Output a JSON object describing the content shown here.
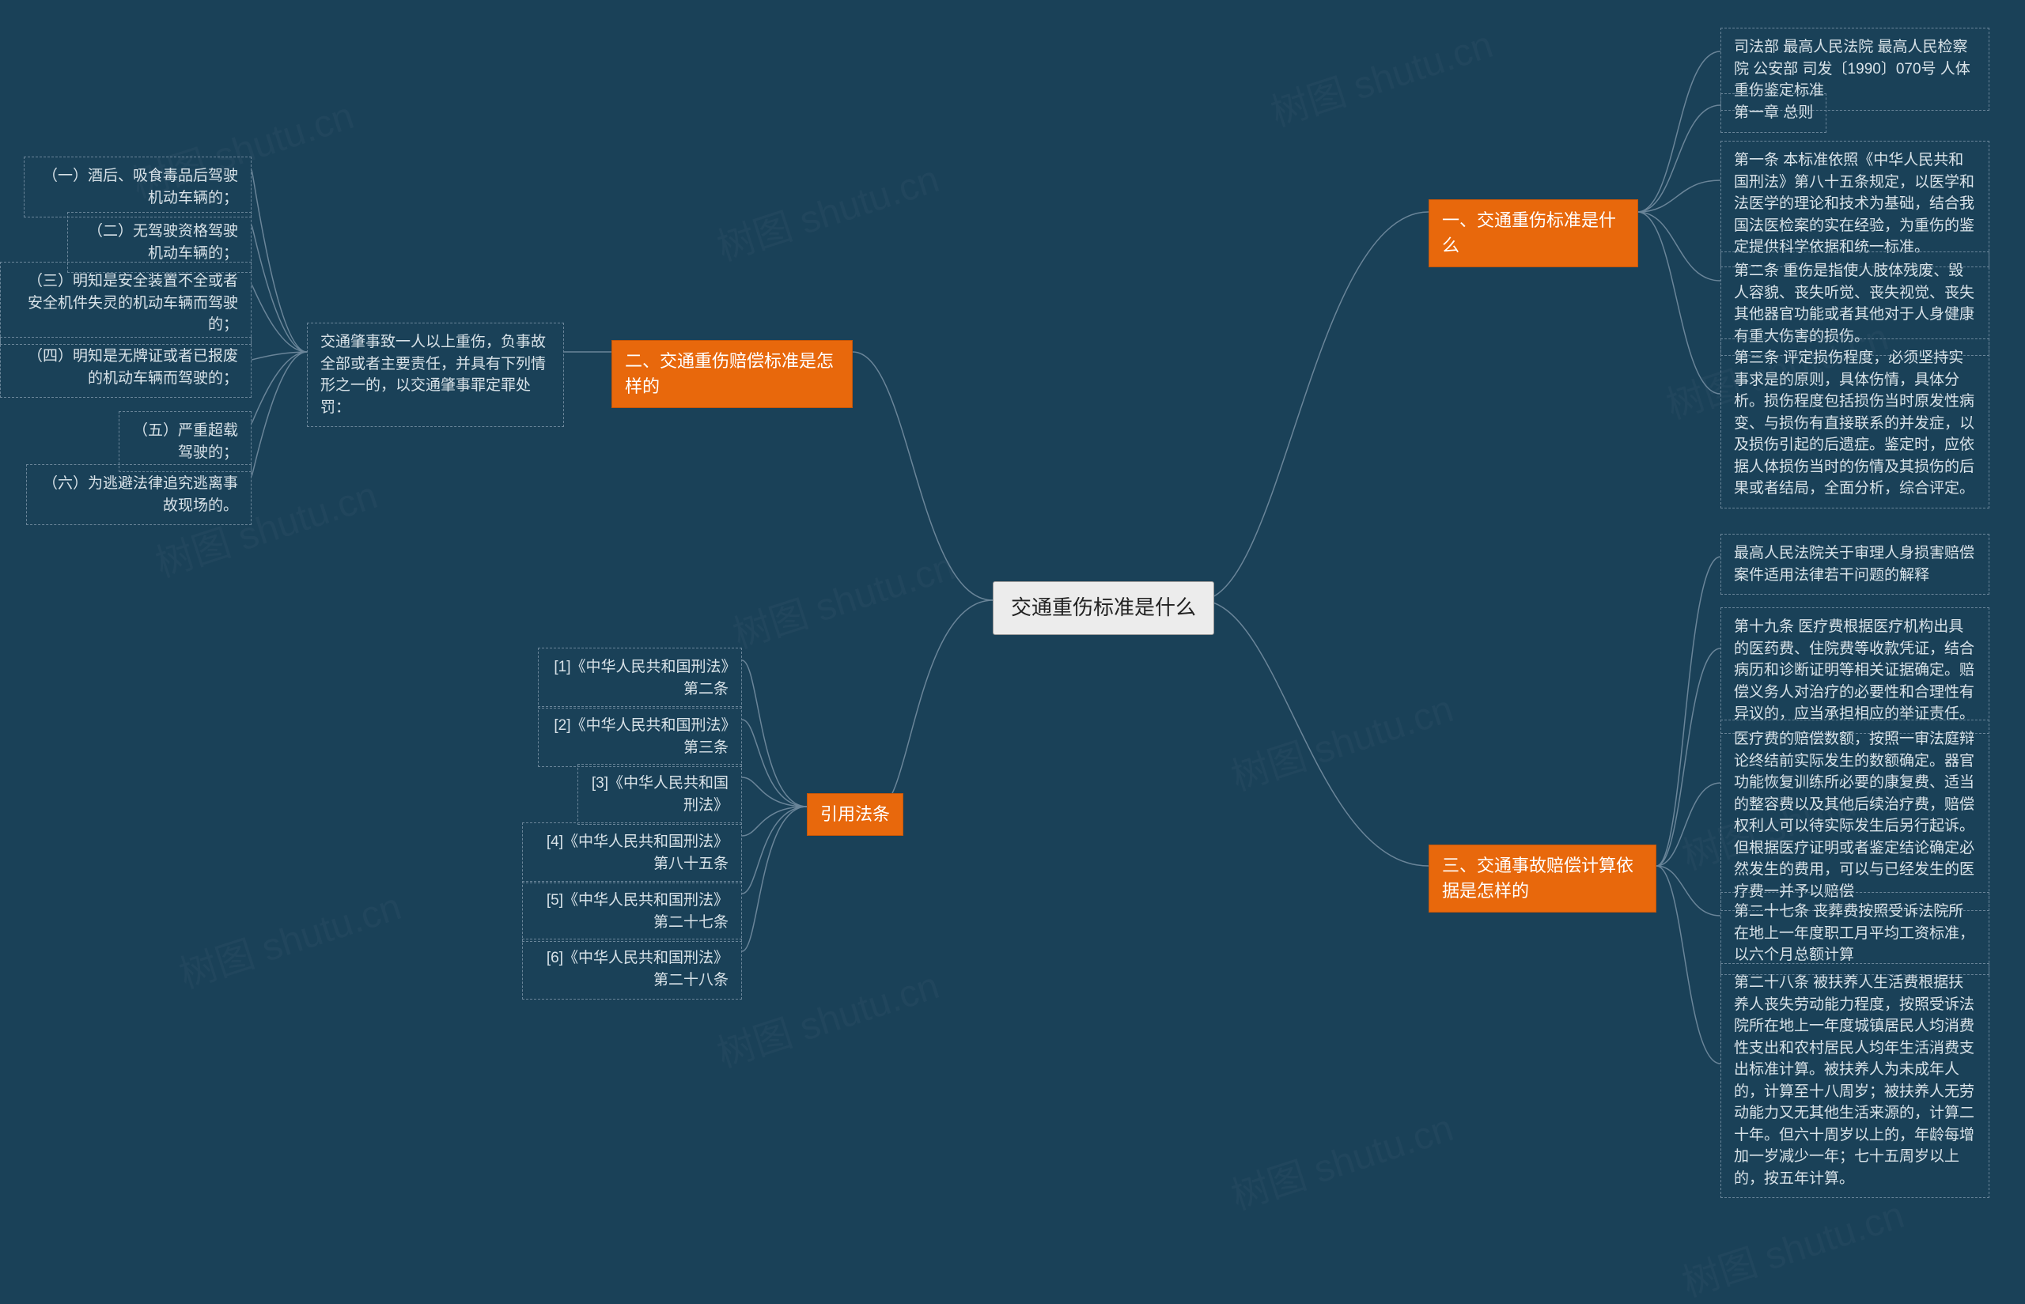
{
  "watermark": "树图 shutu.cn",
  "root": {
    "title": "交通重伤标准是什么"
  },
  "branches": {
    "b1": {
      "title": "一、交通重伤标准是什么",
      "children": [
        "司法部 最高人民法院 最高人民检察院 公安部 司发〔1990〕070号 人体重伤鉴定标准",
        "第一章 总则",
        "第一条 本标准依照《中华人民共和国刑法》第八十五条规定，以医学和法医学的理论和技术为基础，结合我国法医检案的实在经验，为重伤的鉴定提供科学依据和统一标准。",
        "第二条 重伤是指使人肢体残废、毁人容貌、丧失听觉、丧失视觉、丧失其他器官功能或者其他对于人身健康有重大伤害的损伤。",
        "第三条 评定损伤程度，必须坚持实事求是的原则，具体伤情，具体分析。损伤程度包括损伤当时原发性病变、与损伤有直接联系的并发症，以及损伤引起的后遗症。鉴定时，应依据人体损伤当时的伤情及其损伤的后果或者结局，全面分析，综合评定。"
      ]
    },
    "b3": {
      "title": "三、交通事故赔偿计算依据是怎样的",
      "children": [
        "最高人民法院关于审理人身损害赔偿案件适用法律若干问题的解释",
        "第十九条 医疗费根据医疗机构出具的医药费、住院费等收款凭证，结合病历和诊断证明等相关证据确定。赔偿义务人对治疗的必要性和合理性有异议的，应当承担相应的举证责任。",
        "医疗费的赔偿数额，按照一审法庭辩论终结前实际发生的数额确定。器官功能恢复训练所必要的康复费、适当的整容费以及其他后续治疗费，赔偿权利人可以待实际发生后另行起诉。但根据医疗证明或者鉴定结论确定必然发生的费用，可以与已经发生的医疗费一并予以赔偿",
        "第二十七条 丧葬费按照受诉法院所在地上一年度职工月平均工资标准，以六个月总额计算",
        "第二十八条 被扶养人生活费根据扶养人丧失劳动能力程度，按照受诉法院所在地上一年度城镇居民人均消费性支出和农村居民人均年生活消费支出标准计算。被扶养人为未成年人的，计算至十八周岁；被扶养人无劳动能力又无其他生活来源的，计算二十年。但六十周岁以上的，年龄每增加一岁减少一年；七十五周岁以上的，按五年计算。"
      ]
    },
    "b2": {
      "title": "二、交通重伤赔偿标准是怎样的",
      "intermediate": "交通肇事致一人以上重伤，负事故全部或者主要责任，并具有下列情形之一的，以交通肇事罪定罪处罚：",
      "children": [
        "（一）酒后、吸食毒品后驾驶机动车辆的；",
        "（二）无驾驶资格驾驶机动车辆的；",
        "（三）明知是安全装置不全或者安全机件失灵的机动车辆而驾驶的；",
        "（四）明知是无牌证或者已报废的机动车辆而驾驶的；",
        "（五）严重超载驾驶的；",
        "（六）为逃避法律追究逃离事故现场的。"
      ]
    },
    "b4": {
      "title": "引用法条",
      "children": [
        "[1]《中华人民共和国刑法》第二条",
        "[2]《中华人民共和国刑法》第三条",
        "[3]《中华人民共和国刑法》",
        "[4]《中华人民共和国刑法》第八十五条",
        "[5]《中华人民共和国刑法》第二十七条",
        "[6]《中华人民共和国刑法》第二十八条"
      ]
    }
  }
}
